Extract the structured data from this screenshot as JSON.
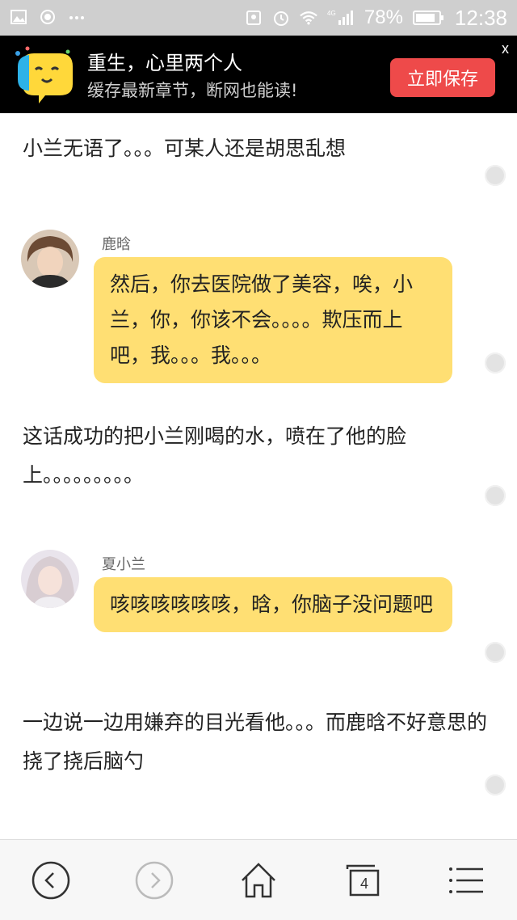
{
  "status_bar": {
    "battery_percent": "78%",
    "time": "12:38",
    "network": "4G",
    "icons": [
      "image-icon",
      "record-icon",
      "more-dots-icon",
      "location-icon",
      "alarm-icon",
      "wifi-icon",
      "signal-icon",
      "battery-icon"
    ]
  },
  "banner": {
    "title": "重生，心里两个人",
    "subtitle": "缓存最新章节，断网也能读!",
    "save_label": "立即保存",
    "close_label": "x",
    "accent": "#ee4a4a"
  },
  "story": {
    "blocks": [
      {
        "type": "narration",
        "text": "小兰无语了。。。可某人还是胡思乱想"
      },
      {
        "type": "dialog",
        "speaker": "鹿晗",
        "text": "然后，你去医院做了美容，唉，小兰，你，你该不会。。。。欺压而上吧，我。。。我。。。"
      },
      {
        "type": "narration",
        "text": "这话成功的把小兰刚喝的水，喷在了他的脸上。。。。。。。。。"
      },
      {
        "type": "dialog",
        "speaker": "夏小兰",
        "text": "咳咳咳咳咳咳，晗，你脑子没问题吧"
      },
      {
        "type": "narration",
        "text": "一边说一边用嫌弃的目光看他。。。而鹿晗不好意思的挠了挠后脑勺"
      }
    ],
    "bubble_color": "#ffdf73"
  },
  "bottom_nav": {
    "tab_count": "4",
    "icons": [
      "back-icon",
      "forward-icon",
      "home-icon",
      "tabs-icon",
      "menu-icon"
    ]
  }
}
